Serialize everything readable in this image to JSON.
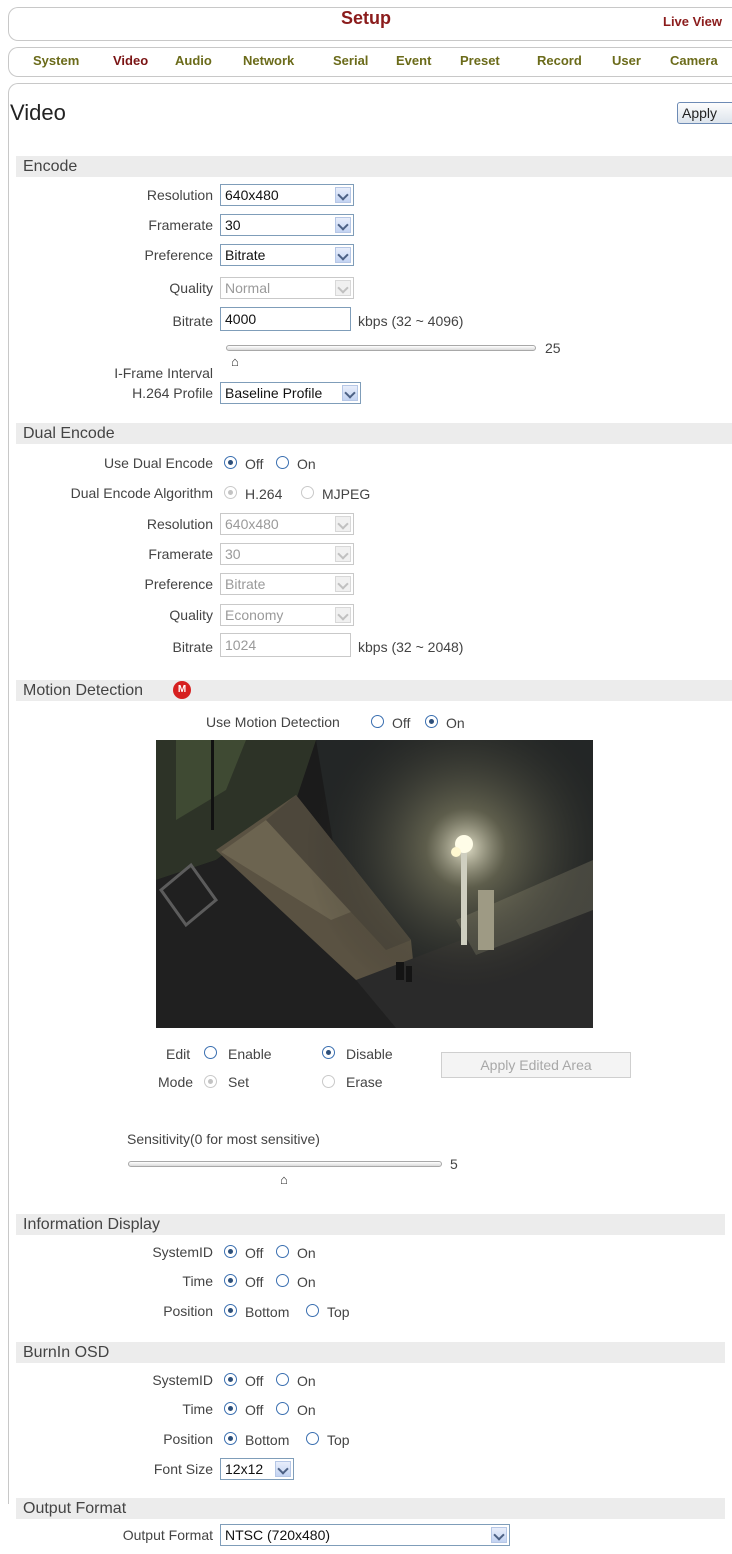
{
  "header": {
    "title": "Setup",
    "live_view": "Live View"
  },
  "tabs": [
    "System",
    "Video",
    "Audio",
    "Network",
    "Serial",
    "Event",
    "Preset",
    "Record",
    "User",
    "Camera"
  ],
  "page": {
    "title": "Video",
    "apply_label": "Apply"
  },
  "encode": {
    "section_title": "Encode",
    "resolution_label": "Resolution",
    "resolution_value": "640x480",
    "framerate_label": "Framerate",
    "framerate_value": "30",
    "preference_label": "Preference",
    "preference_value": "Bitrate",
    "quality_label": "Quality",
    "quality_value": "Normal",
    "bitrate_label": "Bitrate",
    "bitrate_value": "4000",
    "bitrate_range": "kbps (32 ~ 4096)",
    "iframe_label": "I-Frame Interval",
    "iframe_value": "25",
    "profile_label": "H.264 Profile",
    "profile_value": "Baseline Profile"
  },
  "dual_encode": {
    "section_title": "Dual Encode",
    "use_label": "Use Dual Encode",
    "off": "Off",
    "on": "On",
    "algorithm_label": "Dual Encode Algorithm",
    "alg_h264": "H.264",
    "alg_mjpeg": "MJPEG",
    "resolution_label": "Resolution",
    "resolution_value": "640x480",
    "framerate_label": "Framerate",
    "framerate_value": "30",
    "preference_label": "Preference",
    "preference_value": "Bitrate",
    "quality_label": "Quality",
    "quality_value": "Economy",
    "bitrate_label": "Bitrate",
    "bitrate_value": "1024",
    "bitrate_range": "kbps (32 ~ 2048)"
  },
  "motion": {
    "section_title": "Motion Detection",
    "icon_letter": "M",
    "use_label": "Use Motion Detection",
    "off": "Off",
    "on": "On",
    "edit_label": "Edit",
    "enable": "Enable",
    "disable": "Disable",
    "mode_label": "Mode",
    "set": "Set",
    "erase": "Erase",
    "apply_edited": "Apply Edited Area",
    "sensitivity_label": "Sensitivity(0 for most sensitive)",
    "sensitivity_value": "5"
  },
  "info_display": {
    "section_title": "Information Display",
    "systemid_label": "SystemID",
    "time_label": "Time",
    "position_label": "Position",
    "off": "Off",
    "on": "On",
    "bottom": "Bottom",
    "top": "Top"
  },
  "burnin": {
    "section_title": "BurnIn OSD",
    "systemid_label": "SystemID",
    "time_label": "Time",
    "position_label": "Position",
    "off": "Off",
    "on": "On",
    "bottom": "Bottom",
    "top": "Top",
    "fontsize_label": "Font Size",
    "fontsize_value": "12x12"
  },
  "output": {
    "section_title": "Output Format",
    "label": "Output Format",
    "value": "NTSC (720x480)"
  }
}
